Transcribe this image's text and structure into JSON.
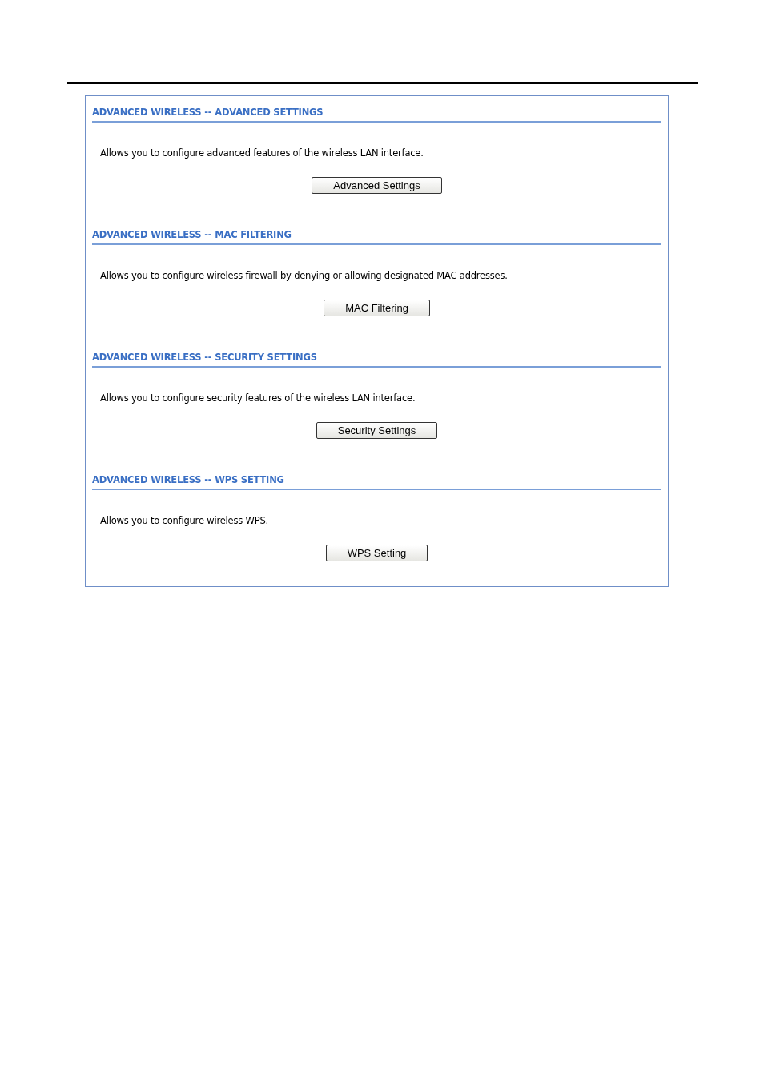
{
  "sections": [
    {
      "heading": "ADVANCED WIRELESS -- ADVANCED SETTINGS",
      "description": "Allows you to configure advanced features of the wireless LAN interface.",
      "button": "Advanced Settings"
    },
    {
      "heading": "ADVANCED WIRELESS -- MAC FILTERING",
      "description": "Allows you to configure wireless firewall by denying or allowing designated MAC addresses.",
      "button": "MAC Filtering"
    },
    {
      "heading": "ADVANCED WIRELESS -- SECURITY SETTINGS",
      "description": "Allows you to configure security features of the wireless LAN interface.",
      "button": "Security Settings"
    },
    {
      "heading": "ADVANCED WIRELESS -- WPS SETTING",
      "description": "Allows you to configure wireless WPS.",
      "button": "WPS Setting"
    }
  ]
}
